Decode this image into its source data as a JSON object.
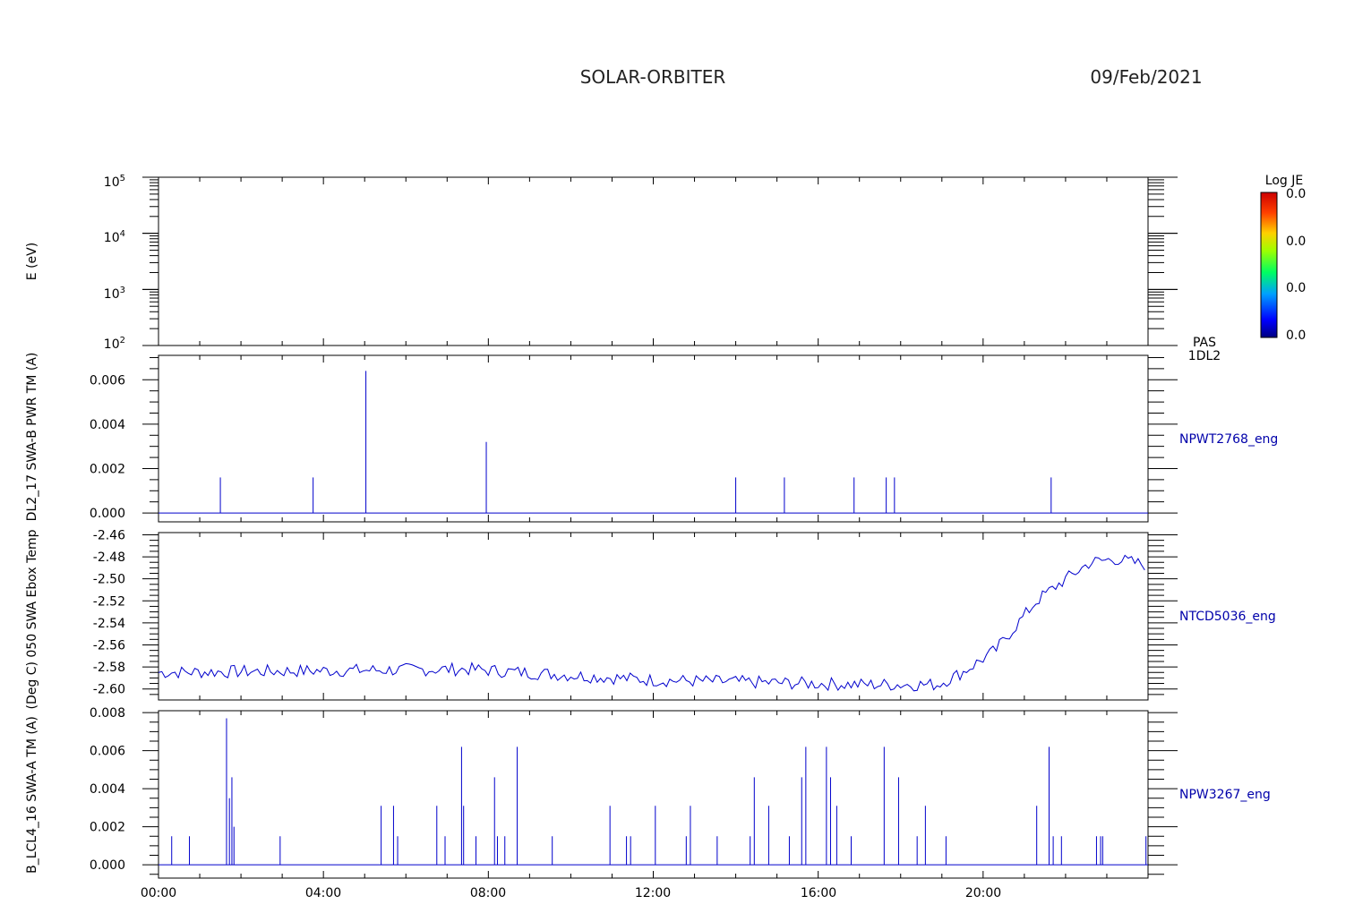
{
  "header": {
    "mission": "SOLAR-ORBITER",
    "date": "09/Feb/2021"
  },
  "colorbar": {
    "title": "Log JE",
    "tick_labels": [
      "0.0",
      "0.0",
      "0.0",
      "0.0"
    ]
  },
  "x_axis": {
    "tick_labels": [
      "00:00",
      "04:00",
      "08:00",
      "12:00",
      "16:00",
      "20:00"
    ]
  },
  "chart_data": [
    {
      "type": "heatmap",
      "ylabel": "E (eV)",
      "yscale": "log",
      "ylim": [
        100,
        100000
      ],
      "ytick_base": "10",
      "ytick_exponents": [
        "5",
        "4",
        "3",
        "2"
      ],
      "right_labels": [
        "PAS",
        "1DL2"
      ],
      "xlim_hours": [
        0,
        24
      ],
      "values": []
    },
    {
      "type": "line",
      "ylabel": "DL2_17 SWA-B PWR TM (A)",
      "right_label": "NPWT2768_eng",
      "ylim": [
        -0.0004,
        0.0071
      ],
      "ytick_labels": [
        "0.006",
        "0.004",
        "0.002",
        "0.000"
      ],
      "ytick_values": [
        0.006,
        0.004,
        0.002,
        0.0
      ],
      "xlim_hours": [
        0,
        24
      ],
      "spikes": [
        {
          "x": 1.5,
          "y": 0.0016
        },
        {
          "x": 3.75,
          "y": 0.0016
        },
        {
          "x": 5.03,
          "y": 0.0064
        },
        {
          "x": 7.95,
          "y": 0.0032
        },
        {
          "x": 14.0,
          "y": 0.0016
        },
        {
          "x": 15.18,
          "y": 0.0016
        },
        {
          "x": 16.87,
          "y": 0.0016
        },
        {
          "x": 17.65,
          "y": 0.0016
        },
        {
          "x": 17.85,
          "y": 0.0016
        },
        {
          "x": 21.65,
          "y": 0.0016
        }
      ]
    },
    {
      "type": "line",
      "ylabel": "(Deg C) 050 SWA Ebox Temp",
      "right_label": "NTCD5036_eng",
      "ylim": [
        -2.61,
        -2.458
      ],
      "ytick_labels": [
        "-2.46",
        "-2.48",
        "-2.50",
        "-2.52",
        "-2.54",
        "-2.56",
        "-2.58",
        "-2.60"
      ],
      "ytick_values": [
        -2.46,
        -2.48,
        -2.5,
        -2.52,
        -2.54,
        -2.56,
        -2.58,
        -2.6
      ],
      "xlim_hours": [
        0,
        24
      ],
      "x_step_hours": 0.08,
      "trend": [
        {
          "x": 0,
          "y": -2.585
        },
        {
          "x": 7.5,
          "y": -2.582
        },
        {
          "x": 12,
          "y": -2.592
        },
        {
          "x": 17,
          "y": -2.596
        },
        {
          "x": 18.9,
          "y": -2.596
        },
        {
          "x": 19.5,
          "y": -2.585
        },
        {
          "x": 20.3,
          "y": -2.565
        },
        {
          "x": 21.3,
          "y": -2.52
        },
        {
          "x": 21.9,
          "y": -2.503
        },
        {
          "x": 22.6,
          "y": -2.485
        },
        {
          "x": 23.2,
          "y": -2.482
        },
        {
          "x": 23.9,
          "y": -2.487
        }
      ]
    },
    {
      "type": "line",
      "ylabel": "B_LCL4_16 SWA-A TM (A)",
      "right_label": "NPW3267_eng",
      "ylim": [
        -0.0007,
        0.0081
      ],
      "ytick_labels": [
        "0.008",
        "0.006",
        "0.004",
        "0.002",
        "0.000"
      ],
      "ytick_values": [
        0.008,
        0.006,
        0.004,
        0.002,
        0.0
      ],
      "xlim_hours": [
        0,
        24
      ],
      "spikes": [
        {
          "x": 0.32,
          "y": 0.0015
        },
        {
          "x": 0.75,
          "y": 0.0015
        },
        {
          "x": 1.65,
          "y": 0.0077
        },
        {
          "x": 1.72,
          "y": 0.0035
        },
        {
          "x": 1.78,
          "y": 0.0046
        },
        {
          "x": 1.83,
          "y": 0.002
        },
        {
          "x": 2.95,
          "y": 0.0015
        },
        {
          "x": 5.4,
          "y": 0.0031
        },
        {
          "x": 5.7,
          "y": 0.0031
        },
        {
          "x": 5.8,
          "y": 0.0015
        },
        {
          "x": 6.75,
          "y": 0.0031
        },
        {
          "x": 6.95,
          "y": 0.0015
        },
        {
          "x": 7.35,
          "y": 0.0062
        },
        {
          "x": 7.4,
          "y": 0.0031
        },
        {
          "x": 7.7,
          "y": 0.0015
        },
        {
          "x": 8.15,
          "y": 0.0046
        },
        {
          "x": 8.22,
          "y": 0.0015
        },
        {
          "x": 8.4,
          "y": 0.0015
        },
        {
          "x": 8.7,
          "y": 0.0062
        },
        {
          "x": 9.55,
          "y": 0.0015
        },
        {
          "x": 10.95,
          "y": 0.0031
        },
        {
          "x": 11.35,
          "y": 0.0015
        },
        {
          "x": 11.45,
          "y": 0.0015
        },
        {
          "x": 12.05,
          "y": 0.0031
        },
        {
          "x": 12.8,
          "y": 0.0015
        },
        {
          "x": 12.9,
          "y": 0.0031
        },
        {
          "x": 13.55,
          "y": 0.0015
        },
        {
          "x": 14.35,
          "y": 0.0015
        },
        {
          "x": 14.45,
          "y": 0.0046
        },
        {
          "x": 14.8,
          "y": 0.0031
        },
        {
          "x": 15.3,
          "y": 0.0015
        },
        {
          "x": 15.6,
          "y": 0.0046
        },
        {
          "x": 15.7,
          "y": 0.0062
        },
        {
          "x": 16.2,
          "y": 0.0062
        },
        {
          "x": 16.3,
          "y": 0.0046
        },
        {
          "x": 16.45,
          "y": 0.0031
        },
        {
          "x": 16.8,
          "y": 0.0015
        },
        {
          "x": 17.6,
          "y": 0.0062
        },
        {
          "x": 17.95,
          "y": 0.0046
        },
        {
          "x": 18.4,
          "y": 0.0015
        },
        {
          "x": 18.6,
          "y": 0.0031
        },
        {
          "x": 19.1,
          "y": 0.0015
        },
        {
          "x": 21.3,
          "y": 0.0031
        },
        {
          "x": 21.6,
          "y": 0.0062
        },
        {
          "x": 21.7,
          "y": 0.0015
        },
        {
          "x": 21.9,
          "y": 0.0015
        },
        {
          "x": 22.75,
          "y": 0.0015
        },
        {
          "x": 22.85,
          "y": 0.0015
        },
        {
          "x": 22.9,
          "y": 0.0015
        },
        {
          "x": 23.95,
          "y": 0.0015
        }
      ]
    }
  ]
}
